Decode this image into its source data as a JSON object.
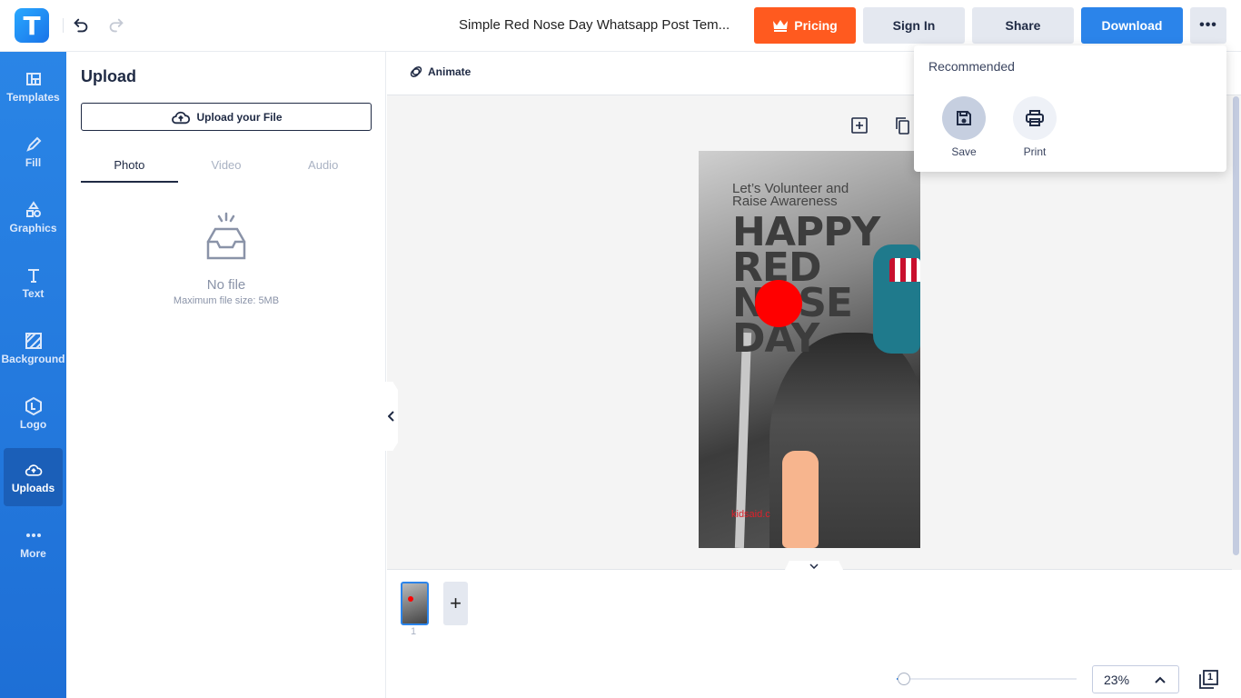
{
  "app": {
    "logo_letter": "T",
    "document_title": "Simple Red Nose Day Whatsapp Post Tem..."
  },
  "header": {
    "pricing_label": "Pricing",
    "signin_label": "Sign In",
    "share_label": "Share",
    "download_label": "Download",
    "more_label": "•••"
  },
  "sidebar": {
    "items": [
      {
        "label": "Templates",
        "icon": "templates-icon"
      },
      {
        "label": "Fill",
        "icon": "pencil-icon"
      },
      {
        "label": "Graphics",
        "icon": "shapes-icon"
      },
      {
        "label": "Text",
        "icon": "text-icon"
      },
      {
        "label": "Background",
        "icon": "background-icon"
      },
      {
        "label": "Logo",
        "icon": "logo-icon"
      },
      {
        "label": "Uploads",
        "icon": "cloud-upload-icon",
        "active": true
      },
      {
        "label": "More",
        "icon": "more-dots-icon"
      }
    ]
  },
  "panel": {
    "title": "Upload",
    "upload_button": "Upload your File",
    "tabs": [
      {
        "label": "Photo",
        "active": true
      },
      {
        "label": "Video",
        "active": false
      },
      {
        "label": "Audio",
        "active": false
      }
    ],
    "empty_title": "No file",
    "empty_subtitle": "Maximum file size: 5MB"
  },
  "editor": {
    "animate_label": "Animate",
    "design": {
      "subtitle": "Let’s Volunteer and Raise Awareness",
      "headline_lines": [
        "HAPPY",
        "RED",
        "NOSE",
        "DAY"
      ],
      "footer_url": "kidsaid.c"
    }
  },
  "pages": {
    "thumbnails": [
      {
        "number": "1",
        "selected": true
      }
    ],
    "add_label": "+"
  },
  "zoom": {
    "value_label": "23%",
    "level_percent": 23
  },
  "page_count_badge": "1",
  "dropdown": {
    "title": "Recommended",
    "items": [
      {
        "label": "Save",
        "icon": "save-icon",
        "active": true
      },
      {
        "label": "Print",
        "icon": "print-icon",
        "active": false
      }
    ]
  },
  "colors": {
    "accent_blue": "#2b84ea",
    "pricing_orange": "#ff5a1f",
    "sidebar_blue": "#2a85e6",
    "nose_red": "#ff0000"
  }
}
